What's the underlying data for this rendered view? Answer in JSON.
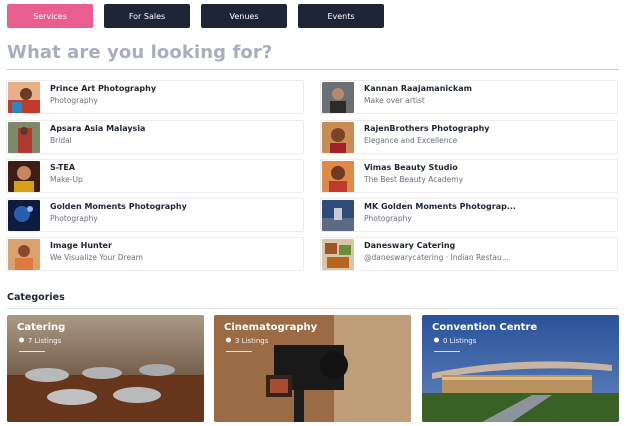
{
  "tabs": [
    {
      "label": "Services",
      "active": true
    },
    {
      "label": "For Sales",
      "active": false
    },
    {
      "label": "Venues",
      "active": false
    },
    {
      "label": "Events",
      "active": false
    }
  ],
  "heading": "What are you looking for?",
  "vendors": [
    {
      "name": "Prince Art Photography",
      "sub": "Photography"
    },
    {
      "name": "Kannan Raajamanickam",
      "sub": "Make over artist"
    },
    {
      "name": "Apsara Asia Malaysia",
      "sub": "Bridal"
    },
    {
      "name": "RajenBrothers Photography",
      "sub": "Elegance and Excellence"
    },
    {
      "name": "S-TEA",
      "sub": "Make-Up"
    },
    {
      "name": "Vimas Beauty Studio",
      "sub": "The Best Beauty Academy"
    },
    {
      "name": "Golden Moments Photography",
      "sub": "Photography"
    },
    {
      "name": "MK Golden Moments Photograp...",
      "sub": "Photography"
    },
    {
      "name": "Image Hunter",
      "sub": "We Visualize Your Dream"
    },
    {
      "name": "Daneswary Catering",
      "sub": "@daneswarycatering · Indian Restau..."
    }
  ],
  "categories_title": "Categories",
  "categories": [
    {
      "name": "Catering",
      "count": "7 Listings"
    },
    {
      "name": "Cinematography",
      "count": "3 Listings"
    },
    {
      "name": "Convention Centre",
      "count": "0 Listings"
    }
  ],
  "colors": {
    "accent": "#ea5e8f",
    "navy": "#1f2537",
    "heading": "#a9adc0"
  }
}
